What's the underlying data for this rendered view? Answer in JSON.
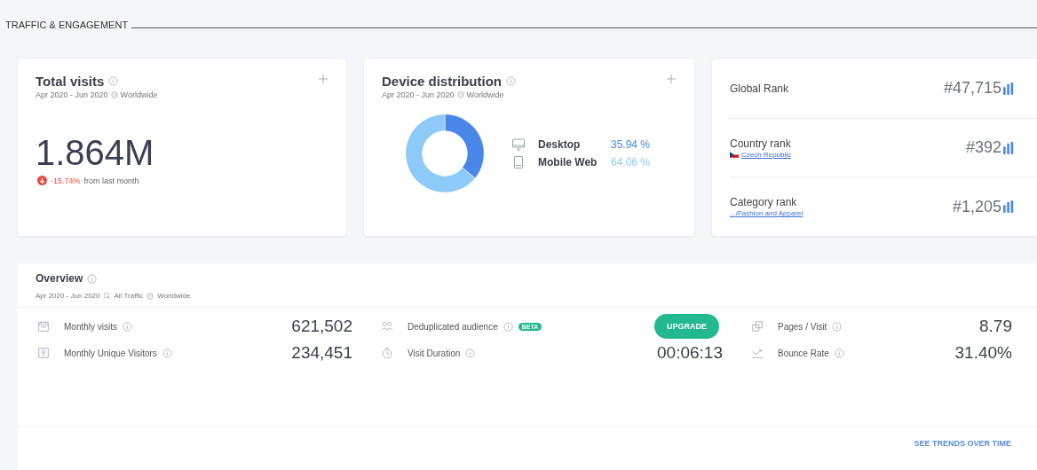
{
  "section_title": "TRAFFIC & ENGAGEMENT",
  "total_visits": {
    "title": "Total visits",
    "period": "Apr 2020 - Jun 2020",
    "region": "Worldwide",
    "value": "1.864M",
    "change": "-15.74%",
    "change_note": "from last month"
  },
  "device_distribution": {
    "title": "Device distribution",
    "period": "Apr 2020 - Jun 2020",
    "region": "Worldwide",
    "legend": [
      {
        "value": "35.94 %",
        "color": "#4a86e8"
      },
      {
        "value": "64.06 %",
        "color": "#8ecaf7"
      }
    ],
    "chart_data": {
      "type": "donut",
      "categories": [
        "Desktop",
        "Mobile Web"
      ],
      "values": [
        35.94,
        64.06
      ]
    }
  },
  "ranks": [
    {
      "label": "Global Rank",
      "value": "#47,715"
    },
    {
      "label": "Country rank",
      "link": "Czech Republic",
      "value": "#392"
    },
    {
      "label": "Category rank",
      "link": ".../Fashion and Apparel",
      "value": "#1,205"
    }
  ],
  "overview": {
    "title": "Overview",
    "period": "Apr 2020 - Jun 2020",
    "traffic": "All Traffic",
    "region": "Worldwide",
    "columns": [
      [
        {
          "label": "Monthly visits",
          "kind": "value",
          "value": "621,502"
        },
        {
          "label": "Monthly Unique Visitors",
          "kind": "value",
          "value": "234,451"
        }
      ],
      [
        {
          "label": "Deduplicated audience",
          "kind": "upgrade",
          "badge": "BETA",
          "button": "UPGRADE"
        },
        {
          "label": "Visit Duration",
          "kind": "value",
          "value": "00:06:13"
        }
      ],
      [
        {
          "label": "Pages / Visit",
          "kind": "value",
          "value": "8.79"
        },
        {
          "label": "Bounce Rate",
          "kind": "value",
          "value": "31.40%"
        }
      ]
    ],
    "trends_link": "SEE TRENDS OVER TIME"
  }
}
